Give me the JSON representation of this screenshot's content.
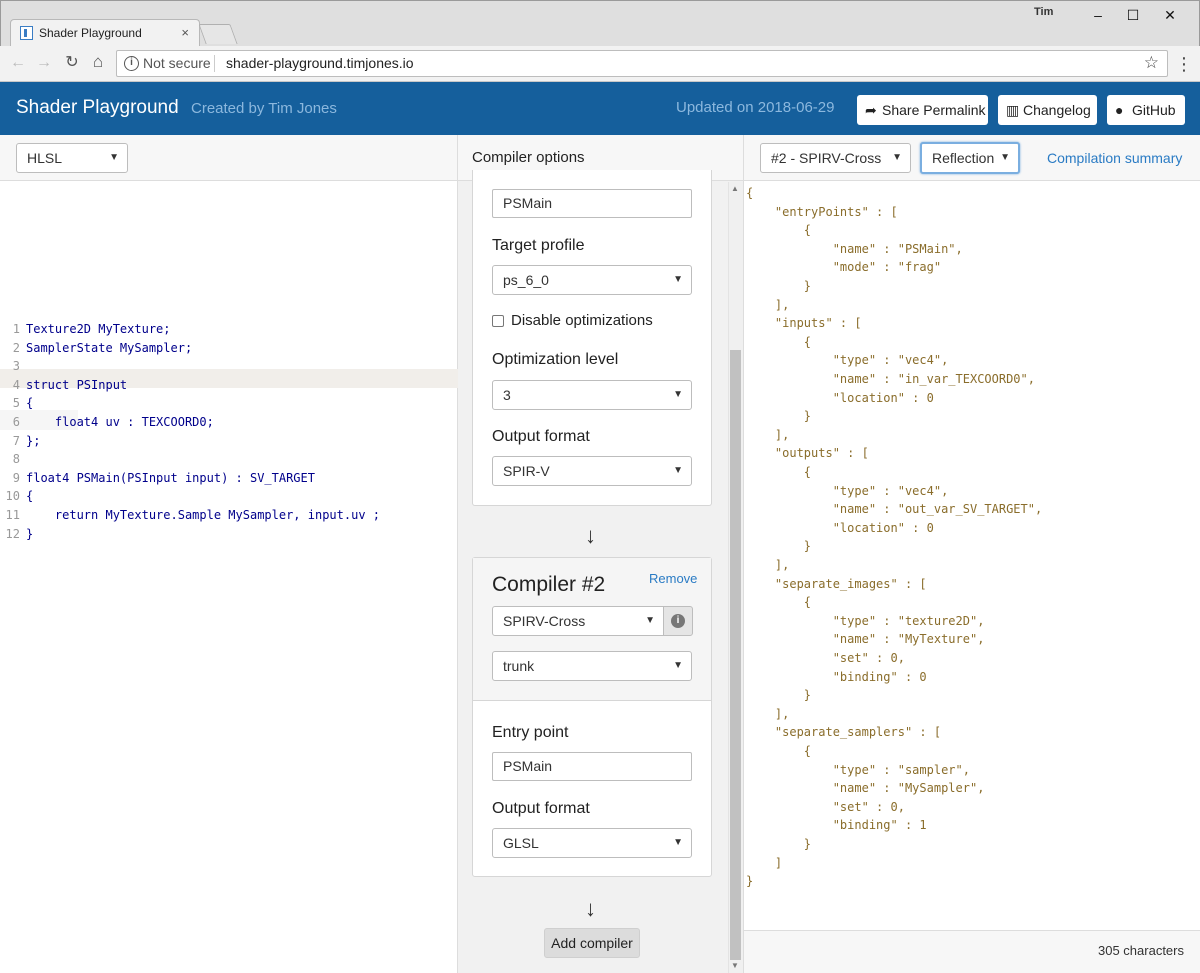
{
  "browser": {
    "tab_title": "Shader Playground",
    "tab_close": "×",
    "window_user": "Tim",
    "security_label": "Not secure",
    "url": "shader-playground.timjones.io"
  },
  "header": {
    "title": "Shader Playground",
    "created_by": "Created by Tim Jones",
    "updated": "Updated on 2018-06-29",
    "share_label": "Share Permalink",
    "changelog_label": "Changelog",
    "github_label": "GitHub"
  },
  "editor": {
    "language": "HLSL",
    "lines": [
      {
        "n": "1",
        "text": "Texture2D MyTexture;"
      },
      {
        "n": "2",
        "text": "SamplerState MySampler;"
      },
      {
        "n": "3",
        "text": ""
      },
      {
        "n": "4",
        "text": "struct PSInput"
      },
      {
        "n": "5",
        "text": "{"
      },
      {
        "n": "6",
        "text": "    float4 uv : TEXCOORD0;"
      },
      {
        "n": "7",
        "text": "};"
      },
      {
        "n": "8",
        "text": ""
      },
      {
        "n": "9",
        "text": "float4 PSMain(PSInput input) : SV_TARGET"
      },
      {
        "n": "10",
        "text": "{"
      },
      {
        "n": "11",
        "text": "    return MyTexture.Sample MySampler, input.uv ;"
      },
      {
        "n": "12",
        "text": "}"
      }
    ]
  },
  "compiler_options": {
    "heading": "Compiler options",
    "compiler1": {
      "entry_point_value": "PSMain",
      "target_profile_label": "Target profile",
      "target_profile_value": "ps_6_0",
      "disable_opt_label": "Disable optimizations",
      "opt_level_label": "Optimization level",
      "opt_level_value": "3",
      "output_format_label": "Output format",
      "output_format_value": "SPIR-V"
    },
    "compiler2": {
      "title": "Compiler #2",
      "remove_label": "Remove",
      "compiler_value": "SPIRV-Cross",
      "version_value": "trunk",
      "entry_point_label": "Entry point",
      "entry_point_value": "PSMain",
      "output_format_label": "Output format",
      "output_format_value": "GLSL"
    },
    "add_compiler_label": "Add compiler",
    "arrow": "↓"
  },
  "output": {
    "stage_select": "#2 - SPIRV-Cross",
    "view_select": "Reflection",
    "summary_link": "Compilation summary",
    "char_count": "305 characters",
    "json_lines": [
      "{",
      "    \"entryPoints\" : [",
      "        {",
      "            \"name\" : \"PSMain\",",
      "            \"mode\" : \"frag\"",
      "        }",
      "    ],",
      "    \"inputs\" : [",
      "        {",
      "            \"type\" : \"vec4\",",
      "            \"name\" : \"in_var_TEXCOORD0\",",
      "            \"location\" : 0",
      "        }",
      "    ],",
      "    \"outputs\" : [",
      "        {",
      "            \"type\" : \"vec4\",",
      "            \"name\" : \"out_var_SV_TARGET\",",
      "            \"location\" : 0",
      "        }",
      "    ],",
      "    \"separate_images\" : [",
      "        {",
      "            \"type\" : \"texture2D\",",
      "            \"name\" : \"MyTexture\",",
      "            \"set\" : 0,",
      "            \"binding\" : 0",
      "        }",
      "    ],",
      "    \"separate_samplers\" : [",
      "        {",
      "            \"type\" : \"sampler\",",
      "            \"name\" : \"MySampler\",",
      "            \"set\" : 0,",
      "            \"binding\" : 1",
      "        }",
      "    ]",
      "}"
    ]
  },
  "colors": {
    "header_bg": "#155f9c",
    "link": "#2a7bc4",
    "json_text": "#8a6d2b"
  }
}
